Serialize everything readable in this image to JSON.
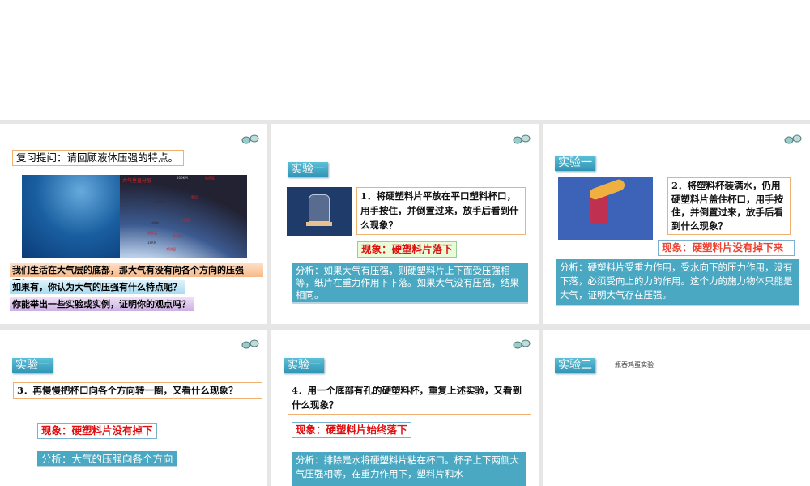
{
  "slides": [
    {
      "review_question": "复习提问：请回顾液体压强的特点。",
      "atmosphere_image": {
        "title": "大气垂直分层",
        "labels": [
          "400KM",
          "散逸层",
          "暖层",
          "80KM",
          "中间层",
          "48KM",
          "臭氧层",
          "平流层",
          "18KM",
          "对流层"
        ]
      },
      "q1": "我们生活在大气层的底部，那大气有没有向各个方向的压强呢？",
      "q2": "如果有，你认为大气的压强有什么特点呢？",
      "q3": "你能举出一些实验或实例，证明你的观点吗？"
    },
    {
      "label": "实验一",
      "question": "1．将硬塑料片平放在平口塑料杯口，用手按住，并倒置过来，放手后看到什么现象？",
      "observation": "现象：硬塑料片落下",
      "analysis": "分析：如果大气有压强，则硬塑料片上下面受压强相等，纸片在重力作用下下落。如果大气没有压强，结果相同。"
    },
    {
      "label": "实验一",
      "question": "2．将塑料杯装满水，仍用硬塑料片盖住杯口，用手按住，并倒置过来，放手后看到什么现象？",
      "observation": "现象：硬塑料片没有掉下来",
      "analysis": "分析：硬塑料片受重力作用，受水向下的压力作用，没有下落，必须受向上的力的作用。这个力的施力物体只能是大气，证明大气存在压强。"
    },
    {
      "label": "实验一",
      "question": "3．再慢慢把杯口向各个方向转一圈，又看什么现象？",
      "observation": "现象：硬塑料片没有掉下",
      "analysis": "分析：大气的压强向各个方向"
    },
    {
      "label": "实验一",
      "question": "4．用一个底部有孔的硬塑料杯，重复上述实验，又看到什么现象？",
      "observation": "现象：硬塑料片始终落下",
      "analysis": "分析：排除是水将硬塑料片粘在杯口。杯子上下两侧大气压强相等，在重力作用下，塑料片和水"
    },
    {
      "label": "实验二",
      "caption": "瓶吞鸡蛋实验"
    }
  ],
  "icons": {
    "slide_icon": "binoculars-icon"
  }
}
